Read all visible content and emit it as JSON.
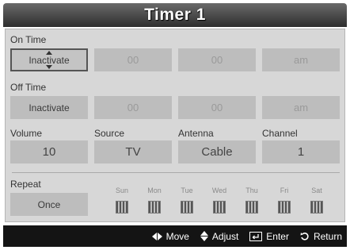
{
  "window": {
    "title": "Timer 1"
  },
  "on_time": {
    "label": "On Time",
    "activation": "Inactivate",
    "hour": "00",
    "minute": "00",
    "ampm": "am"
  },
  "off_time": {
    "label": "Off Time",
    "activation": "Inactivate",
    "hour": "00",
    "minute": "00",
    "ampm": "am"
  },
  "volume": {
    "label": "Volume",
    "value": "10"
  },
  "source": {
    "label": "Source",
    "value": "TV"
  },
  "antenna": {
    "label": "Antenna",
    "value": "Cable"
  },
  "channel": {
    "label": "Channel",
    "value": "1"
  },
  "repeat": {
    "label": "Repeat",
    "value": "Once",
    "days": [
      "Sun",
      "Mon",
      "Tue",
      "Wed",
      "Thu",
      "Fri",
      "Sat"
    ]
  },
  "footer": {
    "move": "Move",
    "adjust": "Adjust",
    "enter": "Enter",
    "return": "Return",
    "icons": [
      "left-right-arrows-icon",
      "up-down-arrows-icon",
      "enter-icon",
      "return-icon"
    ]
  }
}
